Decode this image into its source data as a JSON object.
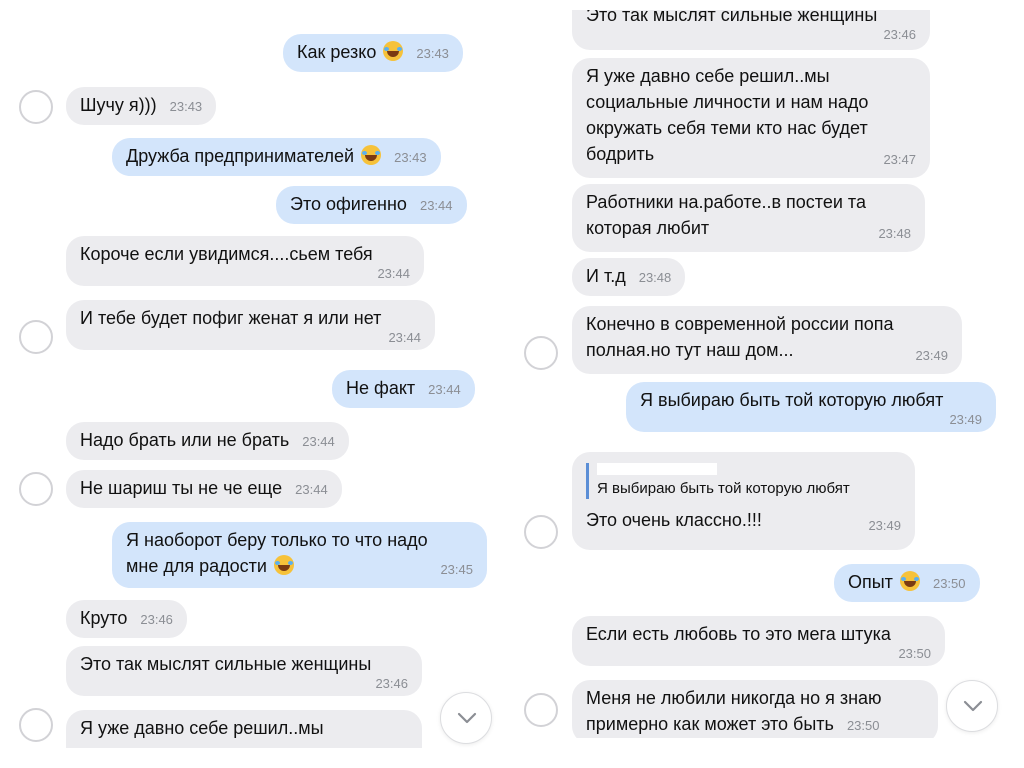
{
  "left": {
    "messages": [
      {
        "text": "Как резко",
        "time": "23:43"
      },
      {
        "text": "Шучу я)))",
        "time": "23:43"
      },
      {
        "text": "Дружба предпринимателей",
        "time": "23:43"
      },
      {
        "text": "Это офигенно",
        "time": "23:44"
      },
      {
        "text": "Короче если увидимся....сьем тебя",
        "time": "23:44"
      },
      {
        "text": "И тебе будет пофиг женат я или нет",
        "time": "23:44"
      },
      {
        "text": "Не факт",
        "time": "23:44"
      },
      {
        "text": "Надо брать или не брать",
        "time": "23:44"
      },
      {
        "text": "Не шариш ты не че еще",
        "time": "23:44"
      },
      {
        "line1": "Я наоборот беру только то что надо",
        "line2": "мне для радости",
        "time": "23:45"
      },
      {
        "text": "Круто",
        "time": "23:46"
      },
      {
        "text": "Это так мыслят сильные женщины",
        "time": "23:46"
      },
      {
        "text": "Я уже давно себе решил..мы"
      }
    ]
  },
  "right": {
    "messages": [
      {
        "text": "Это так мыслят сильные женщины",
        "time": "23:46"
      },
      {
        "line1": "Я уже давно себе решил..мы",
        "line2": "социальные личности и нам надо",
        "line3": "окружать себя теми кто нас будет",
        "line4": "бодрить",
        "time": "23:47"
      },
      {
        "line1": "Работники на.работе..в постеи та",
        "line2": "которая любит",
        "time": "23:48"
      },
      {
        "text": "И т.д",
        "time": "23:48"
      },
      {
        "line1": "Конечно в современной россии попа",
        "line2": "полная.но тут наш дом...",
        "time": "23:49"
      },
      {
        "text": "Я выбираю быть той которую любят",
        "time": "23:49"
      },
      {
        "quote": "Я выбираю быть той которую любят",
        "text": "Это очень классно.!!!",
        "time": "23:49"
      },
      {
        "text": "Опыт",
        "time": "23:50"
      },
      {
        "text": "Если есть любовь то это мега штука",
        "time": "23:50"
      },
      {
        "line1": "Меня не любили никогда но я знаю",
        "line2": "примерно как может это быть",
        "time": "23:50"
      }
    ]
  },
  "icons": {
    "emoji": "laughing-tears-emoji",
    "scroll": "chevron-down-icon"
  },
  "colors": {
    "incoming": "#ececef",
    "outgoing": "#d3e5fb",
    "time": "#8b8e94"
  }
}
